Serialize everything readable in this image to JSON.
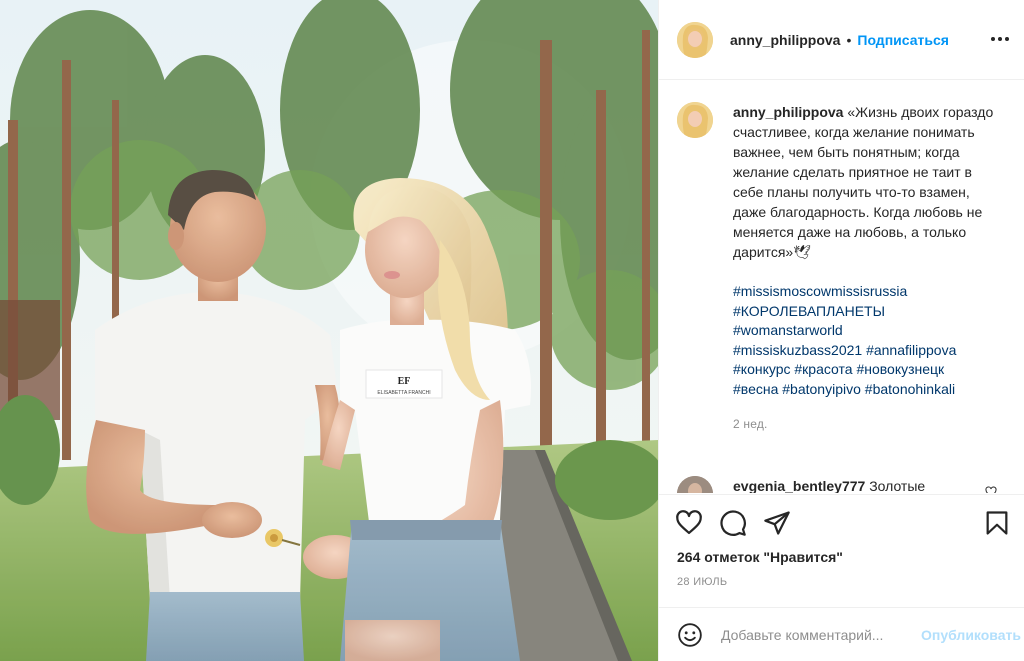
{
  "photo": {
    "alt": "Фото",
    "shirt_logo_text": "ELISABETTA FRANCHI",
    "shirt_logo_mark": "EF"
  },
  "header": {
    "username": "anny_philippova",
    "separator": "•",
    "follow_label": "Подписаться",
    "more_icon": "more-horizontal-icon"
  },
  "caption": {
    "username": "anny_philippova",
    "text": "«Жизнь двоих гораздо счастливее, когда желание понимать важнее, чем быть понятным; когда желание сделать приятное не таит в себе планы получить что-то взамен, даже благодарность. Когда любовь не меняется даже на любовь, а только дарится»🕊",
    "hashtags": [
      "#missismoscowmissisrussia",
      "#КОРОЛЕВАПЛАНЕТЫ",
      "#womanstarworld"
    ],
    "hashtag_lines": [
      [
        "#missiskuzbass2021",
        "#annafilippova"
      ],
      [
        "#конкурс",
        "#красота",
        "#новокузнецк"
      ],
      [
        "#весна",
        "#batonyipivo",
        "#batonohinkali"
      ]
    ],
    "age": "2 нед."
  },
  "comment": {
    "username": "evgenia_bentley777",
    "text": "Золотые"
  },
  "actions": {
    "like_icon": "heart-icon",
    "comment_icon": "comment-icon",
    "share_icon": "share-icon",
    "save_icon": "bookmark-icon",
    "likes_text": "264 отметок \"Нравится\"",
    "date": "28 ИЮЛЬ"
  },
  "add_comment": {
    "emoji_icon": "emoji-icon",
    "placeholder": "Добавьте комментарий...",
    "publish_label": "Опубликовать"
  },
  "colors": {
    "link_blue": "#0095f6",
    "hashtag_blue": "#00376b",
    "muted_gray": "#8e8e8e",
    "publish_disabled": "#b2dffc"
  }
}
